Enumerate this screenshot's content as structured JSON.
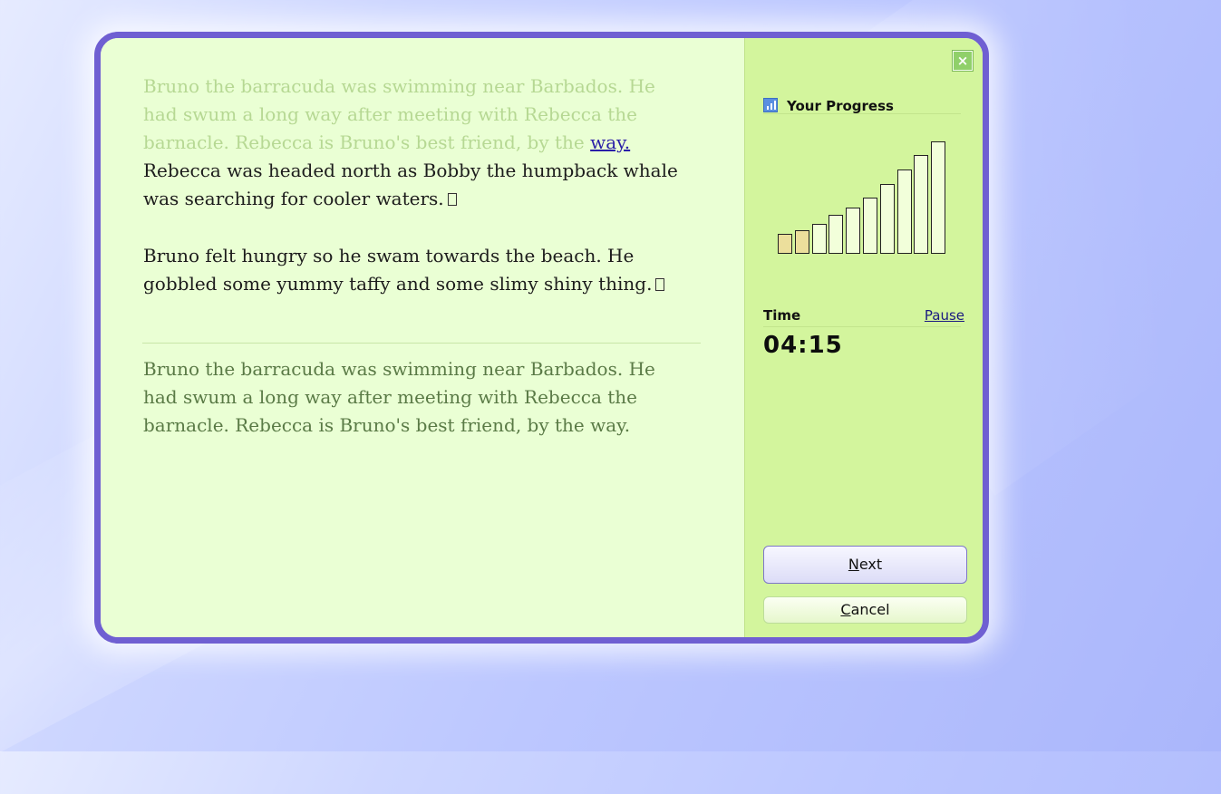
{
  "dialog": {
    "passage": {
      "faded_text": "Bruno the barracuda was swimming near Barbados. He had swum a long way after meeting with Rebecca the barnacle. Rebecca is Bruno's best friend, by the",
      "highlight_word": "way.",
      "active_text_1": "Rebecca was headed north as Bobby the humpback whale was searching for cooler waters.",
      "active_text_2": "Bruno felt hungry so he swam towards the beach. He gobbled some yummy taffy and some slimy shiny thing."
    },
    "source_text": "Bruno the barracuda was swimming near Barbados. He had swum a long way after meeting with Rebecca the barnacle. Rebecca is Bruno's best friend, by the way."
  },
  "sidebar": {
    "close_icon": "close-icon",
    "progress": {
      "title": "Your Progress",
      "icon": "bar-chart-icon",
      "steps_total": 10,
      "steps_done": 2
    },
    "time": {
      "label": "Time",
      "pause_label": "Pause",
      "value": "04:15"
    },
    "buttons": {
      "next_key": "N",
      "next_rest": "ext",
      "cancel_key": "C",
      "cancel_rest": "ancel"
    }
  },
  "colors": {
    "frame": "#6f5fd2",
    "main_bg": "#eaffd4",
    "side_bg": "#d3f59d",
    "link": "#2a1ea8",
    "bar_done": "#ecdf9c"
  }
}
